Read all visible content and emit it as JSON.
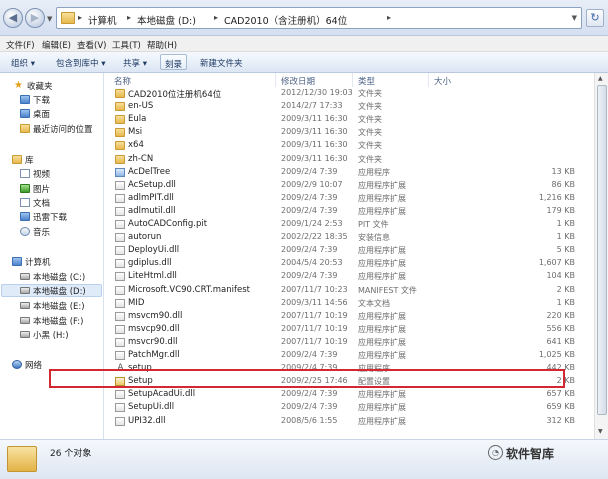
{
  "address_bar": {
    "crumbs": [
      "计算机",
      "本地磁盘 (D:)",
      "CAD2010（含注册机）64位"
    ]
  },
  "menu": [
    "文件(F)",
    "编辑(E)",
    "查看(V)",
    "工具(T)",
    "帮助(H)"
  ],
  "toolbar": {
    "organize": "组织 ▾",
    "include_in_library": "包含到库中 ▾",
    "share": "共享 ▾",
    "burn": "刻录",
    "new_folder": "新建文件夹"
  },
  "nav": {
    "favorites_header": "收藏夹",
    "favorites": [
      "下载",
      "桌面",
      "最近访问的位置"
    ],
    "libraries_header": "库",
    "libraries": [
      "视频",
      "图片",
      "文档",
      "迅雷下载",
      "音乐"
    ],
    "computer_header": "计算机",
    "drives": [
      "本地磁盘 (C:)",
      "本地磁盘 (D:)",
      "本地磁盘 (E:)",
      "本地磁盘 (F:)",
      "小黑 (H:)"
    ],
    "network": "网络"
  },
  "columns": {
    "name": "名称",
    "date": "修改日期",
    "type": "类型",
    "size": "大小"
  },
  "files": [
    {
      "name": "CAD2010位注册机64位",
      "date": "2012/12/30 19:03",
      "type": "文件夹",
      "size": "",
      "icon": "folder"
    },
    {
      "name": "en-US",
      "date": "2014/2/7 17:33",
      "type": "文件夹",
      "size": "",
      "icon": "folder"
    },
    {
      "name": "Eula",
      "date": "2009/3/11 16:30",
      "type": "文件夹",
      "size": "",
      "icon": "folder"
    },
    {
      "name": "Msi",
      "date": "2009/3/11 16:30",
      "type": "文件夹",
      "size": "",
      "icon": "folder"
    },
    {
      "name": "x64",
      "date": "2009/3/11 16:30",
      "type": "文件夹",
      "size": "",
      "icon": "folder"
    },
    {
      "name": "zh-CN",
      "date": "2009/3/11 16:30",
      "type": "文件夹",
      "size": "",
      "icon": "folder"
    },
    {
      "name": "AcDelTree",
      "date": "2009/2/4 7:39",
      "type": "应用程序",
      "size": "13 KB",
      "icon": "exe"
    },
    {
      "name": "AcSetup.dll",
      "date": "2009/2/9 10:07",
      "type": "应用程序扩展",
      "size": "86 KB",
      "icon": "dll"
    },
    {
      "name": "adlmPIT.dll",
      "date": "2009/2/4 7:39",
      "type": "应用程序扩展",
      "size": "1,216 KB",
      "icon": "dll"
    },
    {
      "name": "adlmutil.dll",
      "date": "2009/2/4 7:39",
      "type": "应用程序扩展",
      "size": "179 KB",
      "icon": "dll"
    },
    {
      "name": "AutoCADConfig.pit",
      "date": "2009/1/24 2:53",
      "type": "PIT 文件",
      "size": "1 KB",
      "icon": "dll"
    },
    {
      "name": "autorun",
      "date": "2002/2/22 18:35",
      "type": "安装信息",
      "size": "1 KB",
      "icon": "dll"
    },
    {
      "name": "DeployUi.dll",
      "date": "2009/2/4 7:39",
      "type": "应用程序扩展",
      "size": "5 KB",
      "icon": "dll"
    },
    {
      "name": "gdiplus.dll",
      "date": "2004/5/4 20:53",
      "type": "应用程序扩展",
      "size": "1,607 KB",
      "icon": "dll"
    },
    {
      "name": "LiteHtml.dll",
      "date": "2009/2/4 7:39",
      "type": "应用程序扩展",
      "size": "104 KB",
      "icon": "dll"
    },
    {
      "name": "Microsoft.VC90.CRT.manifest",
      "date": "2007/11/7 10:23",
      "type": "MANIFEST 文件",
      "size": "2 KB",
      "icon": "dll"
    },
    {
      "name": "MID",
      "date": "2009/3/11 14:56",
      "type": "文本文档",
      "size": "1 KB",
      "icon": "dll"
    },
    {
      "name": "msvcm90.dll",
      "date": "2007/11/7 10:19",
      "type": "应用程序扩展",
      "size": "220 KB",
      "icon": "dll"
    },
    {
      "name": "msvcp90.dll",
      "date": "2007/11/7 10:19",
      "type": "应用程序扩展",
      "size": "556 KB",
      "icon": "dll"
    },
    {
      "name": "msvcr90.dll",
      "date": "2007/11/7 10:19",
      "type": "应用程序扩展",
      "size": "641 KB",
      "icon": "dll"
    },
    {
      "name": "PatchMgr.dll",
      "date": "2009/2/4 7:39",
      "type": "应用程序扩展",
      "size": "1,025 KB",
      "icon": "dll"
    },
    {
      "name": "setup",
      "date": "2009/2/4 7:39",
      "type": "应用程序",
      "size": "442 KB",
      "icon": "a"
    },
    {
      "name": "Setup",
      "date": "2009/2/25 17:46",
      "type": "配置设置",
      "size": "2 KB",
      "icon": "setup"
    },
    {
      "name": "SetupAcadUi.dll",
      "date": "2009/2/4 7:39",
      "type": "应用程序扩展",
      "size": "657 KB",
      "icon": "dll"
    },
    {
      "name": "SetupUi.dll",
      "date": "2009/2/4 7:39",
      "type": "应用程序扩展",
      "size": "659 KB",
      "icon": "dll"
    },
    {
      "name": "UPI32.dll",
      "date": "2008/5/6 1:55",
      "type": "应用程序扩展",
      "size": "312 KB",
      "icon": "dll"
    }
  ],
  "status": {
    "count": "26 个对象",
    "watermark": "软件智库"
  }
}
